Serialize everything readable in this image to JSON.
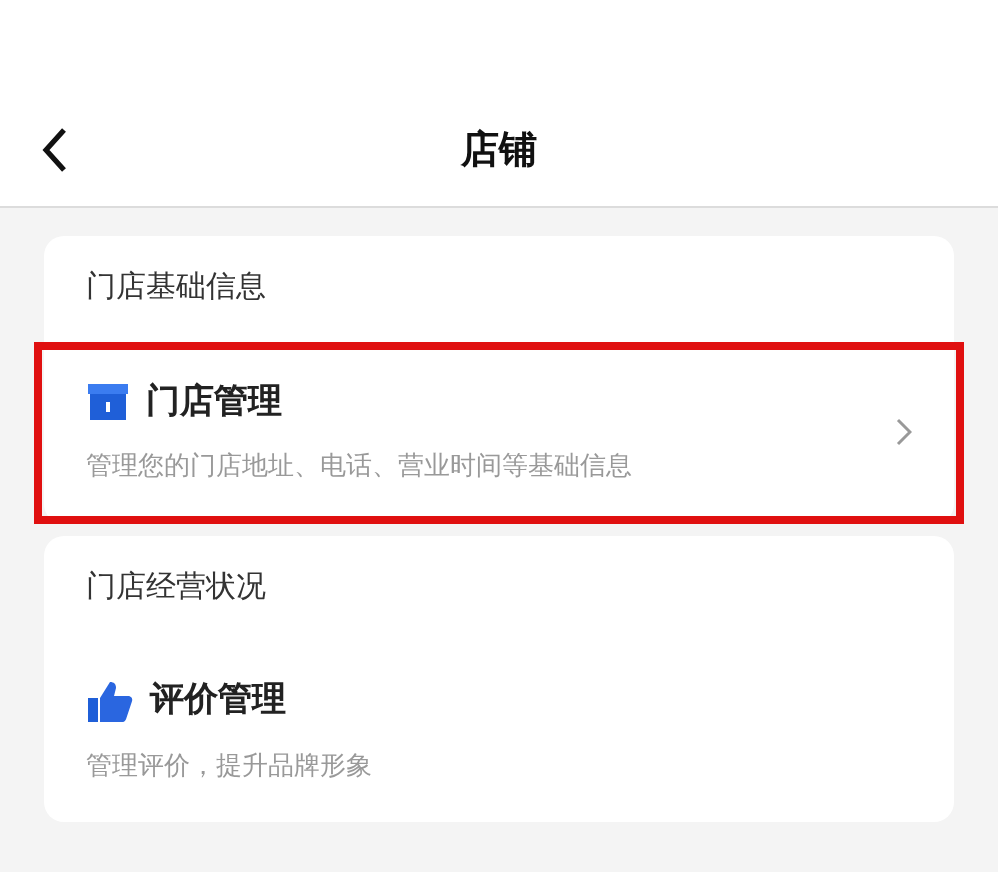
{
  "header": {
    "title": "店铺"
  },
  "sections": [
    {
      "title": "门店基础信息",
      "items": [
        {
          "kind": "store",
          "title": "门店管理",
          "description": "管理您的门店地址、电话、营业时间等基础信息",
          "chevron": true,
          "highlighted": true
        }
      ]
    },
    {
      "title": "门店经营状况",
      "items": [
        {
          "kind": "review",
          "title": "评价管理",
          "description": "管理评价，提升品牌形象",
          "chevron": false,
          "highlighted": false
        }
      ]
    }
  ]
}
